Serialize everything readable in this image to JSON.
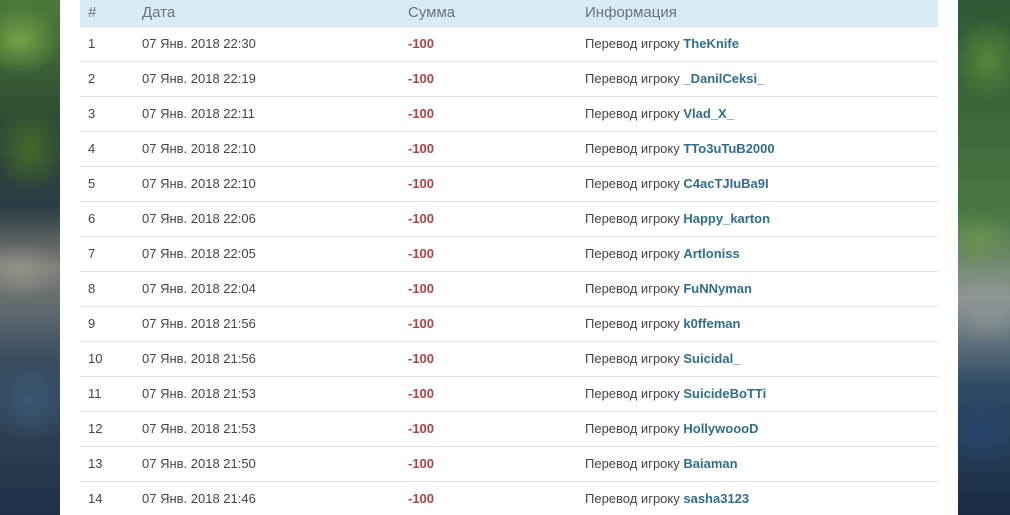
{
  "table": {
    "columns": [
      "#",
      "Дата",
      "Сумма",
      "Информация"
    ],
    "rows": [
      {
        "num": "1",
        "date": "07 Янв. 2018 22:30",
        "amount": "-100",
        "info_prefix": "Перевод игроку",
        "player": "TheKnife"
      },
      {
        "num": "2",
        "date": "07 Янв. 2018 22:19",
        "amount": "-100",
        "info_prefix": "Перевод игроку",
        "player": "_DanilCeksi_"
      },
      {
        "num": "3",
        "date": "07 Янв. 2018 22:11",
        "amount": "-100",
        "info_prefix": "Перевод игроку",
        "player": "Vlad_X_"
      },
      {
        "num": "4",
        "date": "07 Янв. 2018 22:10",
        "amount": "-100",
        "info_prefix": "Перевод игроку",
        "player": "TTo3uTuB2000"
      },
      {
        "num": "5",
        "date": "07 Янв. 2018 22:10",
        "amount": "-100",
        "info_prefix": "Перевод игроку",
        "player": "C4acTJIuBa9I"
      },
      {
        "num": "6",
        "date": "07 Янв. 2018 22:06",
        "amount": "-100",
        "info_prefix": "Перевод игроку",
        "player": "Happy_karton"
      },
      {
        "num": "7",
        "date": "07 Янв. 2018 22:05",
        "amount": "-100",
        "info_prefix": "Перевод игроку",
        "player": "Artloniss"
      },
      {
        "num": "8",
        "date": "07 Янв. 2018 22:04",
        "amount": "-100",
        "info_prefix": "Перевод игроку",
        "player": "FuNNyman"
      },
      {
        "num": "9",
        "date": "07 Янв. 2018 21:56",
        "amount": "-100",
        "info_prefix": "Перевод игроку",
        "player": "k0ffeman"
      },
      {
        "num": "10",
        "date": "07 Янв. 2018 21:56",
        "amount": "-100",
        "info_prefix": "Перевод игроку",
        "player": "Suicidal_"
      },
      {
        "num": "11",
        "date": "07 Янв. 2018 21:53",
        "amount": "-100",
        "info_prefix": "Перевод игроку",
        "player": "SuicideBoTTi"
      },
      {
        "num": "12",
        "date": "07 Янв. 2018 21:53",
        "amount": "-100",
        "info_prefix": "Перевод игроку",
        "player": "HollywoooD"
      },
      {
        "num": "13",
        "date": "07 Янв. 2018 21:50",
        "amount": "-100",
        "info_prefix": "Перевод игроку",
        "player": "Baiaman"
      },
      {
        "num": "14",
        "date": "07 Янв. 2018 21:46",
        "amount": "-100",
        "info_prefix": "Перевод игроку",
        "player": "sasha3123"
      }
    ]
  },
  "colors": {
    "header_bg": "#d9ecf6",
    "amount_negative": "#b5403f",
    "player_link": "#2f6e8e"
  }
}
